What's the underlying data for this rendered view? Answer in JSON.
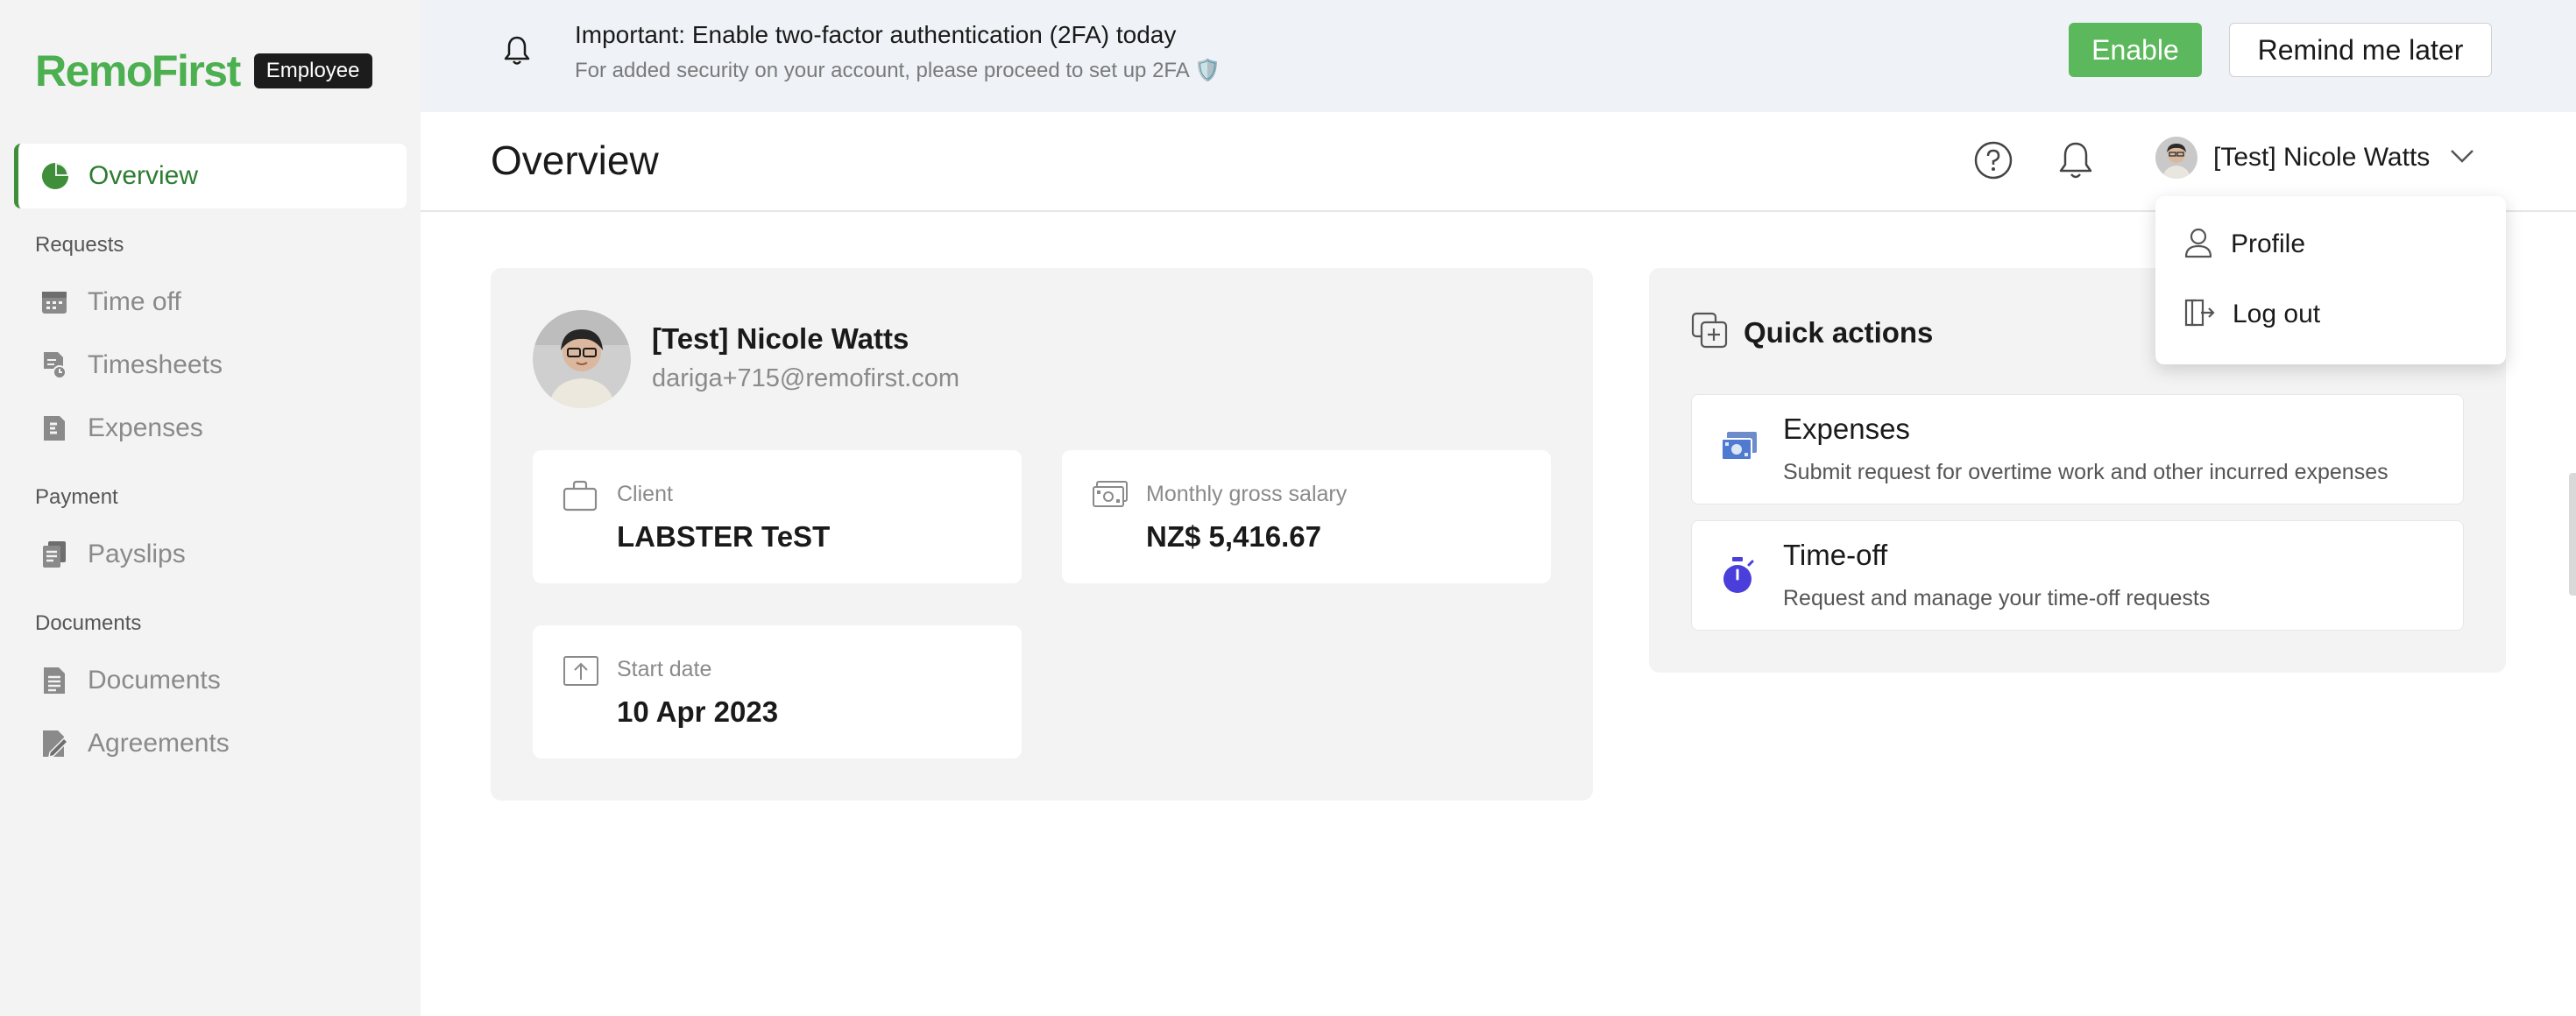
{
  "brand": {
    "logo": "RemoFirst",
    "role_badge": "Employee",
    "accent": "#4caf50"
  },
  "sidebar": {
    "active": {
      "label": "Overview",
      "icon": "pie-chart-icon"
    },
    "sections": [
      {
        "label": "Requests",
        "items": [
          {
            "label": "Time off",
            "icon": "calendar-icon"
          },
          {
            "label": "Timesheets",
            "icon": "timesheet-icon"
          },
          {
            "label": "Expenses",
            "icon": "expense-doc-icon"
          }
        ]
      },
      {
        "label": "Payment",
        "items": [
          {
            "label": "Payslips",
            "icon": "payslip-icon"
          }
        ]
      },
      {
        "label": "Documents",
        "items": [
          {
            "label": "Documents",
            "icon": "document-icon"
          },
          {
            "label": "Agreements",
            "icon": "agreement-icon"
          }
        ]
      }
    ]
  },
  "banner": {
    "title": "Important: Enable two-factor authentication (2FA) today",
    "subtitle": "For added security on your account, please proceed to set up 2FA 🛡️",
    "enable_label": "Enable",
    "remind_label": "Remind me later"
  },
  "header": {
    "title": "Overview",
    "user_name": "[Test] Nicole Watts"
  },
  "user_menu": {
    "items": [
      {
        "label": "Profile",
        "icon": "person-icon"
      },
      {
        "label": "Log out",
        "icon": "logout-icon"
      }
    ]
  },
  "profile": {
    "name": "[Test] Nicole Watts",
    "email": "dariga+715@remofirst.com",
    "client": {
      "label": "Client",
      "value": "LABSTER TeST"
    },
    "salary": {
      "label": "Monthly gross salary",
      "value": "NZ$ 5,416.67"
    },
    "start_date": {
      "label": "Start date",
      "value": "10 Apr 2023"
    }
  },
  "quick_actions": {
    "title": "Quick actions",
    "items": [
      {
        "title": "Expenses",
        "description": "Submit request for overtime work and other incurred expenses",
        "icon": "money-icon"
      },
      {
        "title": "Time-off",
        "description": "Request and manage your time-off requests",
        "icon": "stopwatch-icon"
      }
    ]
  }
}
